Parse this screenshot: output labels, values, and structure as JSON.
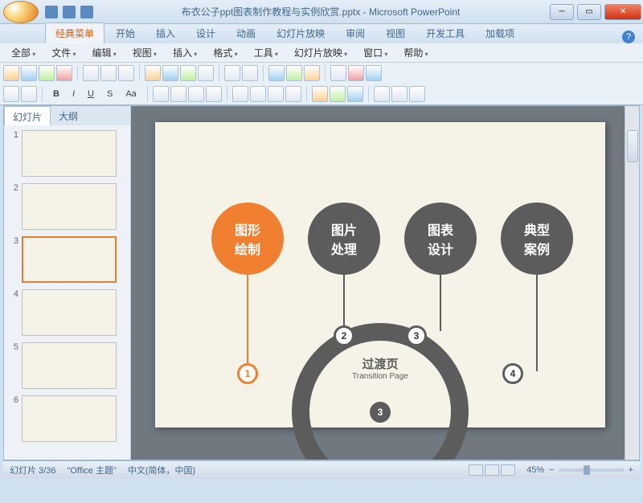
{
  "title": {
    "doc": "布衣公子ppt图表制作教程与实例欣赏.pptx",
    "app": "Microsoft PowerPoint",
    "sep": " - "
  },
  "ribbon": {
    "tabs": [
      "经典菜单",
      "开始",
      "插入",
      "设计",
      "动画",
      "幻灯片放映",
      "审阅",
      "视图",
      "开发工具",
      "加载项"
    ],
    "active": 0
  },
  "menus": [
    "全部",
    "文件",
    "编辑",
    "视图",
    "插入",
    "格式",
    "工具",
    "幻灯片放映",
    "窗口",
    "帮助"
  ],
  "panel": {
    "tabs": [
      "幻灯片",
      "大纲"
    ],
    "active": 0,
    "count": 6,
    "selected": 3
  },
  "slide": {
    "circles": [
      "图形\n绘制",
      "图片\n处理",
      "图表\n设计",
      "典型\n案例"
    ],
    "center_title": "过渡页",
    "center_sub": "Transition Page",
    "nodes": [
      "1",
      "2",
      "3",
      "4"
    ],
    "mid_node": "3"
  },
  "status": {
    "slide": "幻灯片 3/36",
    "theme": "\"Office 主题\"",
    "lang": "中文(简体，中国)",
    "zoom": "45%"
  }
}
